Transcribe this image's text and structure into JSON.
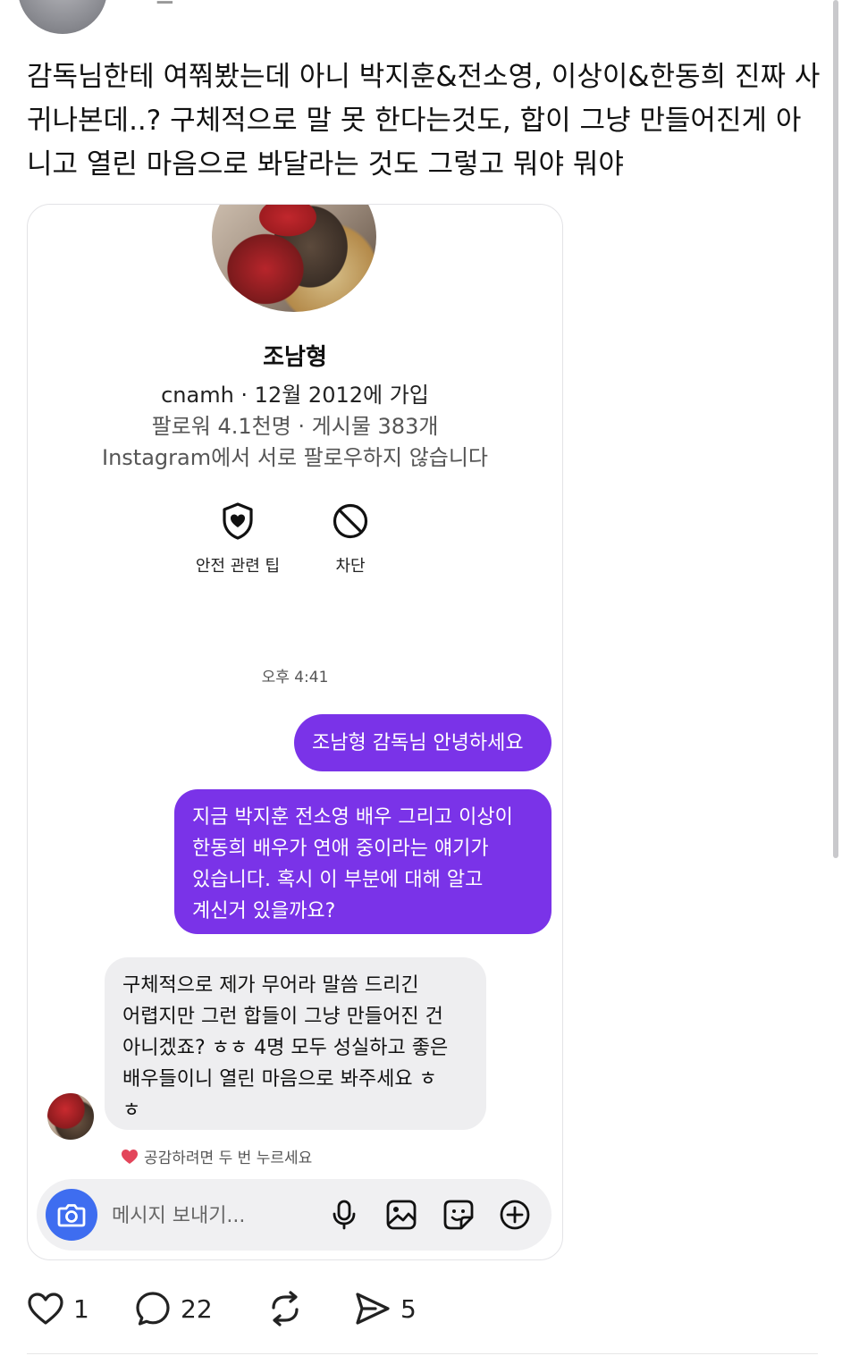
{
  "author": {
    "name_partial": "· ▁ · · · · · · · · ·"
  },
  "post": {
    "text": "감독님한테 여쭤봤는데 아니 박지훈&전소영, 이상이&한동희 진짜 사귀나본데..? 구체적으로 말 못 한다는것도, 합이 그냥 만들어진게 아니고 열린 마음으로 봐달라는 것도 그렇고 뭐야 뭐야"
  },
  "screenshot": {
    "profile": {
      "name": "조남형",
      "handle_joined": "cnamh · 12월 2012에 가입",
      "stats": "팔로워 4.1천명 · 게시물 383개",
      "follow_status": "Instagram에서 서로 팔로우하지 않습니다"
    },
    "actions": {
      "safety_label": "안전 관련 팁",
      "block_label": "차단"
    },
    "timestamp": "오후 4:41",
    "messages": {
      "outgoing_1": "조남형 감독님 안녕하세요",
      "outgoing_2": "지금 박지훈 전소영 배우 그리고 이상이\n한동희 배우가 연애 중이라는 얘기가\n있습니다.  혹시 이 부분에 대해 알고\n계신거 있을까요?",
      "incoming_1": "구체적으로 제가 무어라 말씀 드리긴\n어렵지만 그런 합들이 그냥 만들어진 건\n아니겠죠? ㅎㅎ 4명 모두 성실하고 좋은\n배우들이니 열린 마음으로 봐주세요 ㅎ\nㅎ"
    },
    "like_hint": "공감하려면 두 번 누르세요",
    "composer": {
      "placeholder": "메시지 보내기..."
    }
  },
  "post_actions": {
    "likes": "1",
    "replies": "22",
    "shares": "5"
  },
  "colors": {
    "outgoing_bubble": "#7a33e8",
    "incoming_bubble": "#eeeef0",
    "camera_button": "#3e6df0",
    "heart": "#e3455a"
  }
}
